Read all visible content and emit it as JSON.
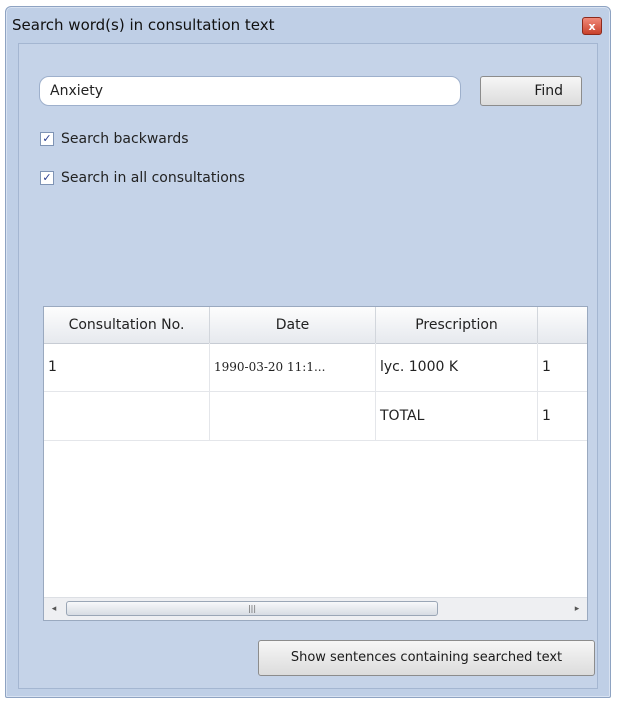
{
  "window": {
    "title": "Search word(s) in consultation text",
    "close_glyph": "x"
  },
  "search": {
    "value": "Anxiety",
    "find_label": "Find"
  },
  "options": [
    {
      "label": "Search backwards",
      "checked": true
    },
    {
      "label": "Search in all consultations",
      "checked": true
    }
  ],
  "table": {
    "columns": [
      "Consultation No.",
      "Date",
      "Prescription",
      ""
    ],
    "rows": [
      [
        "1",
        "1990-03-20 11:1...",
        "lyc. 1000 K",
        "1"
      ],
      [
        "",
        "",
        "TOTAL",
        "1"
      ]
    ]
  },
  "scrollbar": {
    "left_arrow": "◂",
    "right_arrow": "▸",
    "thumb_grip": "|||"
  },
  "actions": {
    "show_sentences_label": "Show sentences containing searched text"
  }
}
